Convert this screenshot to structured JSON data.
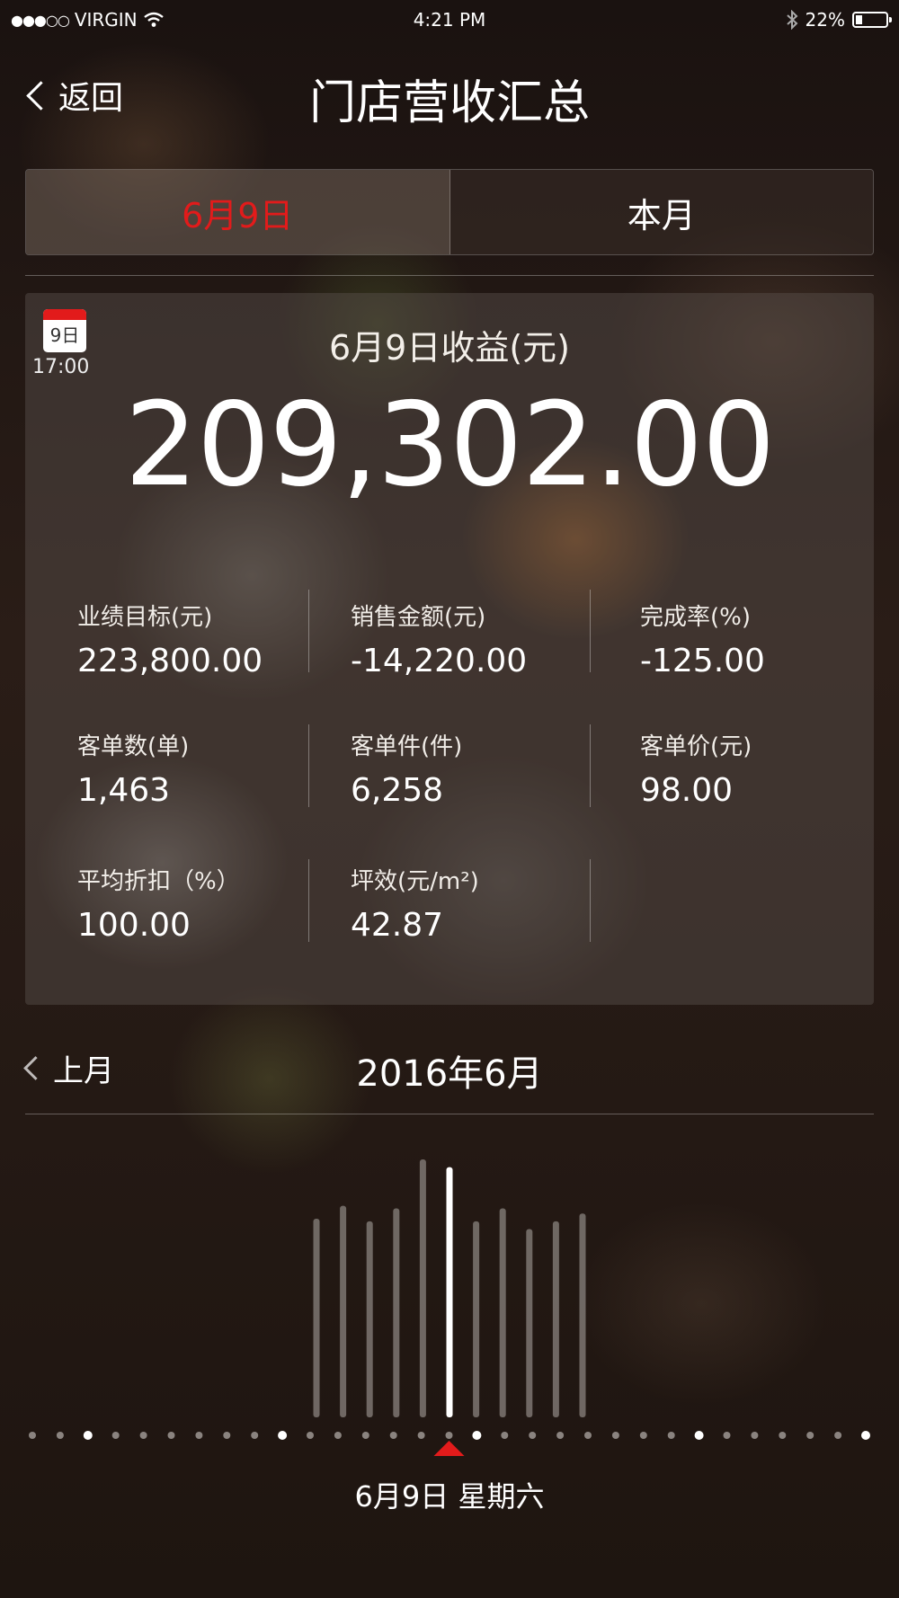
{
  "status_bar": {
    "carrier": "VIRGIN",
    "time": "4:21 PM",
    "battery": "22%",
    "battery_level": 0.22,
    "icons": [
      "signal-dots-icon",
      "wifi-icon",
      "bluetooth-icon",
      "battery-icon"
    ]
  },
  "nav": {
    "back_label": "返回",
    "title": "门店营收汇总"
  },
  "segments": {
    "items": [
      {
        "label": "6月9日",
        "active": true
      },
      {
        "label": "本月",
        "active": false
      }
    ]
  },
  "colors": {
    "accent": "#e21b1b",
    "active_bar": "#ffffff",
    "inactive_bar": "#8a837f"
  },
  "revenue": {
    "calendar_day": "9日",
    "time": "17:00",
    "title": "6月9日收益(元)",
    "amount": "209,302.00"
  },
  "metrics": [
    {
      "label": "业绩目标(元)",
      "value": "223,800.00"
    },
    {
      "label": "销售金额(元)",
      "value": "-14,220.00"
    },
    {
      "label": "完成率(%)",
      "value": "-125.00"
    },
    {
      "label": "客单数(单)",
      "value": "1,463"
    },
    {
      "label": "客单件(件)",
      "value": "6,258"
    },
    {
      "label": "客单价(元)",
      "value": "98.00"
    },
    {
      "label": "平均折扣（%）",
      "value": "100.00"
    },
    {
      "label": "坪效(元/m²)",
      "value": "42.87"
    }
  ],
  "month_nav": {
    "prev_label": "上月",
    "current": "2016年6月"
  },
  "day_chart": {
    "bar_levels": [
      0.77,
      0.82,
      0.76,
      0.81,
      1.0,
      0.97,
      0.76,
      0.81,
      0.73,
      0.76,
      0.79
    ],
    "selected_bar": 5,
    "day_count": 31,
    "highlighted_day_dots": [
      3,
      10,
      17,
      25,
      31
    ],
    "selected_day": 16
  },
  "selected_day_label": "6月9日 星期六"
}
